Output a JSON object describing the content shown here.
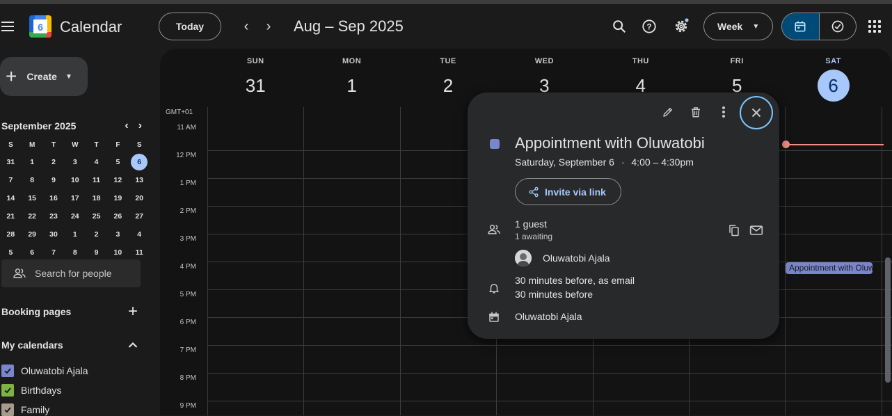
{
  "app": {
    "name": "Calendar",
    "logo_day": "6"
  },
  "toolbar": {
    "today_label": "Today",
    "date_range": "Aug – Sep 2025",
    "view_label": "Week",
    "icons": [
      "menu-icon",
      "search-icon",
      "help-icon",
      "settings-icon",
      "calendar-view-icon",
      "tasks-icon",
      "apps-icon"
    ]
  },
  "sidebar": {
    "create_label": "Create",
    "mini_calendar": {
      "month_label": "September 2025",
      "dow": [
        "S",
        "M",
        "T",
        "W",
        "T",
        "F",
        "S"
      ],
      "weeks": [
        [
          "31",
          "1",
          "2",
          "3",
          "4",
          "5",
          "6"
        ],
        [
          "7",
          "8",
          "9",
          "10",
          "11",
          "12",
          "13"
        ],
        [
          "14",
          "15",
          "16",
          "17",
          "18",
          "19",
          "20"
        ],
        [
          "21",
          "22",
          "23",
          "24",
          "25",
          "26",
          "27"
        ],
        [
          "28",
          "29",
          "30",
          "1",
          "2",
          "3",
          "4"
        ],
        [
          "5",
          "6",
          "7",
          "8",
          "9",
          "10",
          "11"
        ]
      ],
      "selected": "6"
    },
    "search_people_placeholder": "Search for people",
    "booking_pages_label": "Booking pages",
    "my_calendars_label": "My calendars",
    "calendars": [
      {
        "name": "Oluwatobi Ajala",
        "color": "#7986cb"
      },
      {
        "name": "Birthdays",
        "color": "#7cb342"
      },
      {
        "name": "Family",
        "color": "#a79b8e"
      }
    ]
  },
  "week": {
    "timezone": "GMT+01",
    "days": [
      {
        "dow": "SUN",
        "num": "31"
      },
      {
        "dow": "MON",
        "num": "1"
      },
      {
        "dow": "TUE",
        "num": "2"
      },
      {
        "dow": "WED",
        "num": "3"
      },
      {
        "dow": "THU",
        "num": "4"
      },
      {
        "dow": "FRI",
        "num": "5"
      },
      {
        "dow": "SAT",
        "num": "6",
        "today": true
      }
    ],
    "hours": [
      "11 AM",
      "12 PM",
      "1 PM",
      "2 PM",
      "3 PM",
      "4 PM",
      "5 PM",
      "6 PM",
      "7 PM",
      "8 PM",
      "9 PM"
    ],
    "event_chip": "Appointment with Oluwatobi"
  },
  "popup": {
    "title": "Appointment with Oluwatobi",
    "when_date": "Saturday, September 6",
    "when_time": "4:00 – 4:30pm",
    "invite_label": "Invite via link",
    "guests_count": "1 guest",
    "guests_status": "1 awaiting",
    "guest_name": "Oluwatobi Ajala",
    "reminder_1": "30 minutes before, as email",
    "reminder_2": "30 minutes before",
    "calendar_owner": "Oluwatobi Ajala",
    "event_color": "#7986cb"
  }
}
